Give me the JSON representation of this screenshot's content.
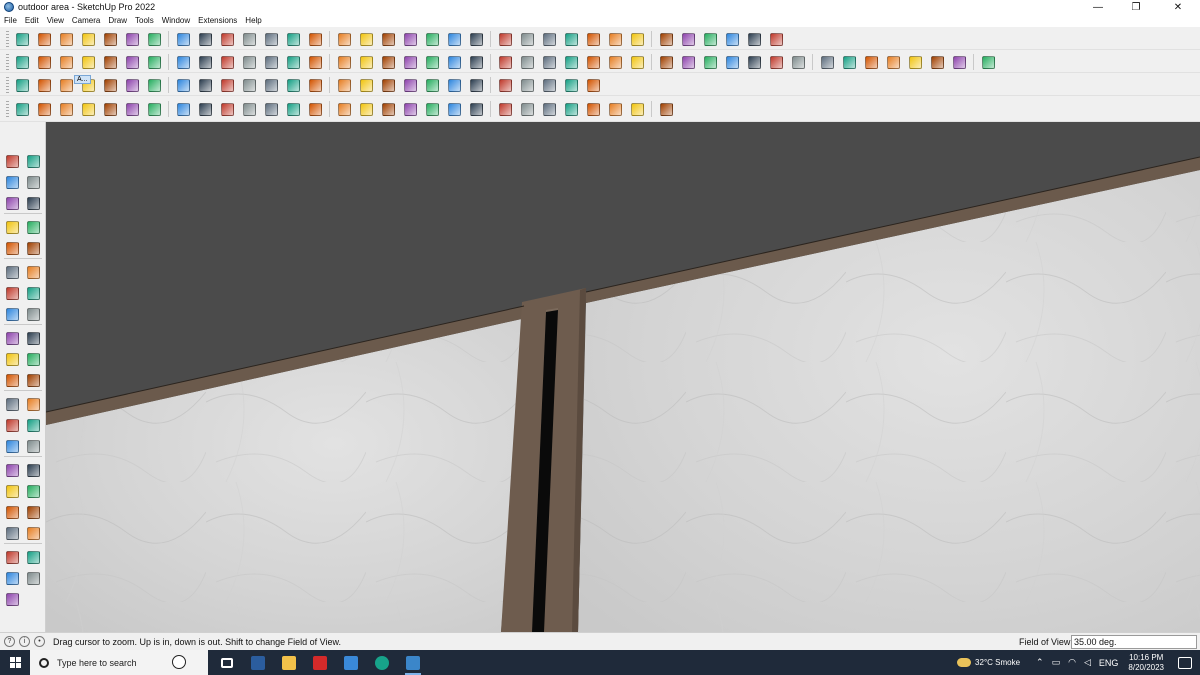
{
  "window": {
    "title": "outdoor area - SketchUp Pro 2022",
    "minimize": "—",
    "restore": "❐",
    "close": "✕"
  },
  "menu": [
    "File",
    "Edit",
    "View",
    "Camera",
    "Draw",
    "Tools",
    "Window",
    "Extensions",
    "Help"
  ],
  "toolbar": {
    "selected_tool_badge": "A..."
  },
  "icons": {
    "toolbar_row1": [
      "zoom-icon",
      "select-icon",
      "eraser-icon",
      "line-icon",
      "arc-icon",
      "shape-icon",
      "push-pull-icon",
      "follow-me-icon",
      "move-icon",
      "rotate-icon",
      "scale-icon",
      "tape-measure-icon",
      "text-icon",
      "paint-bucket-icon",
      "orbit-icon",
      "pan-icon",
      "zoom-icon",
      "zoom-extents-icon",
      "warehouse-icon",
      "extension-warehouse-icon",
      "layout-icon",
      "profile-icon",
      "camera-icon",
      "section-plane-icon",
      "axes-icon",
      "undo-icon",
      "redo-icon",
      "paste-icon"
    ],
    "toolbar_row2": [
      "iso-view-icon",
      "top-view-icon",
      "front-view-icon",
      "right-view-icon",
      "back-view-icon",
      "left-view-icon",
      "bottom-view-icon",
      "lock-icon",
      "xray-icon",
      "wireframe-icon",
      "hidden-line-icon",
      "shaded-icon",
      "textured-icon",
      "monochrome-icon",
      "home-icon",
      "components-icon",
      "model-info-icon",
      "edit-group-icon",
      "shape-circle-icon",
      "shape-polygon-icon",
      "shape-ellipse-icon",
      "shape-rectangle-icon",
      "sandbox-icon",
      "paint-icon",
      "eraser-icon"
    ],
    "toolbar_row3": [
      "solid-tools-icon",
      "union-icon",
      "subtract-icon",
      "trim-icon",
      "split-icon",
      "outer-shell-icon",
      "intersect-icon",
      "add-location-icon",
      "terrain-icon",
      "drape-icon",
      "flip-icon",
      "smoove-icon",
      "stamp-icon",
      "crosshair-icon"
    ],
    "toolbar_row4": [
      "dimension-icon",
      "protractor-icon",
      "arc-3-point-icon",
      "circle-icon",
      "polygon-icon",
      "offset-icon",
      "fillet-icon",
      "chamfer-icon",
      "extrude-icon",
      "revolve-icon",
      "loft-icon",
      "sweep-icon",
      "twist-icon",
      "bend-icon",
      "shell-icon"
    ],
    "left_palette": [
      "select-icon",
      "orbit-icon",
      "paint-bucket-icon",
      "eraser-icon",
      "components-icon",
      "tag-icon",
      "pencil-icon",
      "freehand-icon",
      "rectangle-icon",
      "rotated-rectangle-icon",
      "circle-icon",
      "polygon-icon",
      "arc-icon",
      "pie-icon",
      "arc-2-point-icon",
      "arc-3-point-icon",
      "move-icon",
      "push-pull-icon",
      "rotate-icon",
      "follow-me-icon",
      "scale-icon",
      "offset-icon",
      "tape-measure-icon",
      "dimension-icon",
      "protractor-icon",
      "text-icon",
      "axes-icon",
      "3d-text-icon",
      "orbit-icon",
      "pan-icon",
      "zoom-icon",
      "zoom-window-icon",
      "zoom-extents-icon",
      "previous-view-icon",
      "position-camera-icon",
      "look-around-icon",
      "walk-icon",
      "section-plane-icon",
      "display-sections-icon",
      "section-cuts-icon",
      "fill-icon"
    ],
    "taskbar": [
      "start-icon",
      "search-icon",
      "football-icon",
      "pen-icon",
      "task-view-icon",
      "calculator-icon",
      "file-explorer-icon",
      "acrobat-icon",
      "store-icon",
      "edge-icon",
      "sketchup-icon"
    ]
  },
  "status": {
    "hint": "Drag cursor to zoom.  Up is in, down is out. Shift to change Field of View.",
    "measurement_label": "Field of View",
    "measurement_value": "35.00 deg."
  },
  "taskbar": {
    "search_placeholder": "Type here to search",
    "weather": "32°C  Smoke",
    "language": "ENG",
    "time": "10:16 PM",
    "date": "8/20/2023"
  },
  "colors": {
    "sky": "#4b4b4b",
    "marble": "#d9d9d9",
    "trim": "#6b5a4c",
    "groove": "#0a0a0a",
    "taskbar": "#1f2a3a"
  }
}
